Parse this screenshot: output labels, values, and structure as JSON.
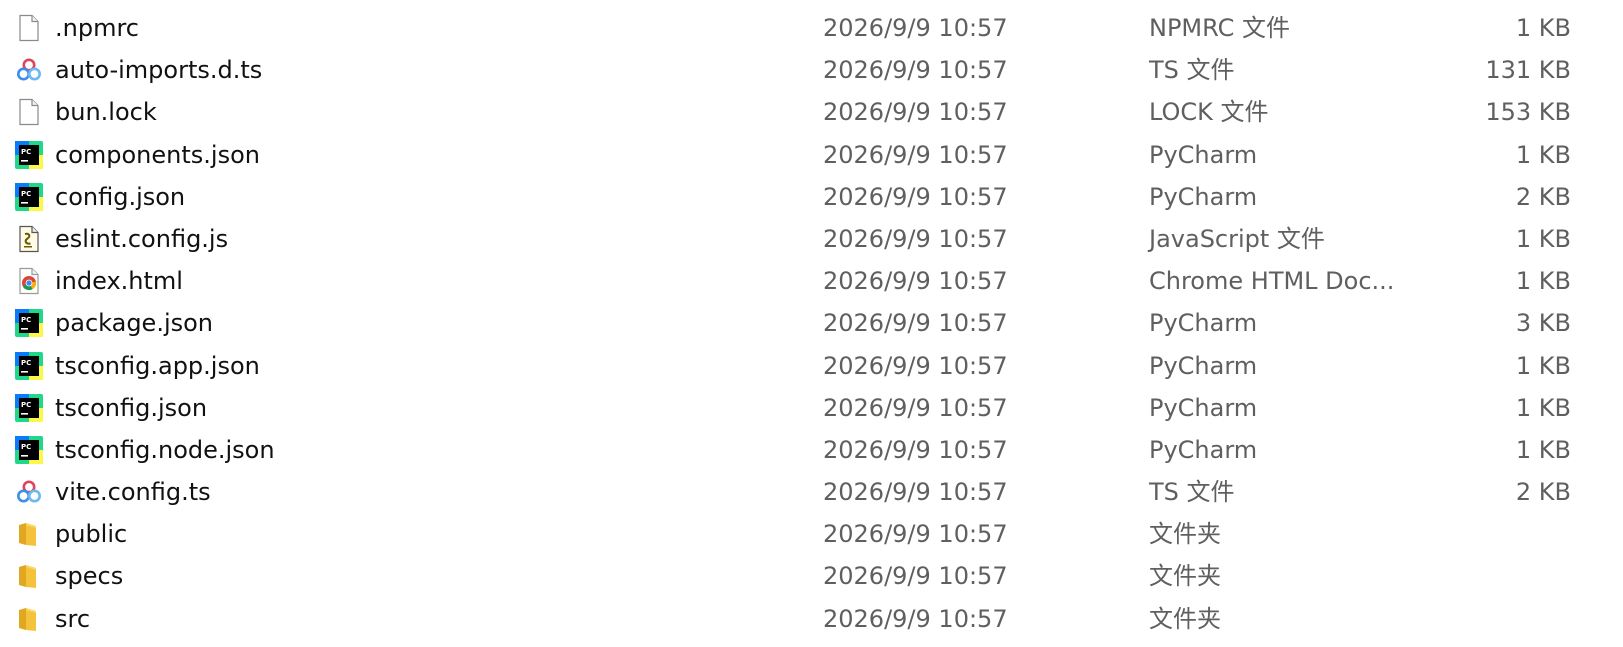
{
  "files": [
    {
      "name": ".npmrc",
      "date": "2026/9/9 10:57",
      "type": "NPMRC 文件",
      "size": "1 KB",
      "icon": "blank-file-icon"
    },
    {
      "name": "auto-imports.d.ts",
      "date": "2026/9/9 10:57",
      "type": "TS 文件",
      "size": "131 KB",
      "icon": "ts-file-icon"
    },
    {
      "name": "bun.lock",
      "date": "2026/9/9 10:57",
      "type": "LOCK 文件",
      "size": "153 KB",
      "icon": "blank-file-icon"
    },
    {
      "name": "components.json",
      "date": "2026/9/9 10:57",
      "type": "PyCharm",
      "size": "1 KB",
      "icon": "pycharm-icon"
    },
    {
      "name": "config.json",
      "date": "2026/9/9 10:57",
      "type": "PyCharm",
      "size": "2 KB",
      "icon": "pycharm-icon"
    },
    {
      "name": "eslint.config.js",
      "date": "2026/9/9 10:57",
      "type": "JavaScript 文件",
      "size": "1 KB",
      "icon": "js-script-icon"
    },
    {
      "name": "index.html",
      "date": "2026/9/9 10:57",
      "type": "Chrome HTML Doc...",
      "size": "1 KB",
      "icon": "chrome-html-icon"
    },
    {
      "name": "package.json",
      "date": "2026/9/9 10:57",
      "type": "PyCharm",
      "size": "3 KB",
      "icon": "pycharm-icon"
    },
    {
      "name": "tsconfig.app.json",
      "date": "2026/9/9 10:57",
      "type": "PyCharm",
      "size": "1 KB",
      "icon": "pycharm-icon"
    },
    {
      "name": "tsconfig.json",
      "date": "2026/9/9 10:57",
      "type": "PyCharm",
      "size": "1 KB",
      "icon": "pycharm-icon"
    },
    {
      "name": "tsconfig.node.json",
      "date": "2026/9/9 10:57",
      "type": "PyCharm",
      "size": "1 KB",
      "icon": "pycharm-icon"
    },
    {
      "name": "vite.config.ts",
      "date": "2026/9/9 10:57",
      "type": "TS 文件",
      "size": "2 KB",
      "icon": "ts-file-icon"
    },
    {
      "name": "public",
      "date": "2026/9/9 10:57",
      "type": "文件夹",
      "size": "",
      "icon": "folder-icon"
    },
    {
      "name": "specs",
      "date": "2026/9/9 10:57",
      "type": "文件夹",
      "size": "",
      "icon": "folder-icon"
    },
    {
      "name": "src",
      "date": "2026/9/9 10:57",
      "type": "文件夹",
      "size": "",
      "icon": "folder-icon"
    }
  ],
  "colors": {
    "folder": "#f5c33b",
    "pycharm_green": "#21d789",
    "pycharm_blue": "#087cfa",
    "pycharm_yellow": "#fcf84a",
    "ts_blue": "#3d8eea",
    "ts_red": "#e0445c"
  }
}
